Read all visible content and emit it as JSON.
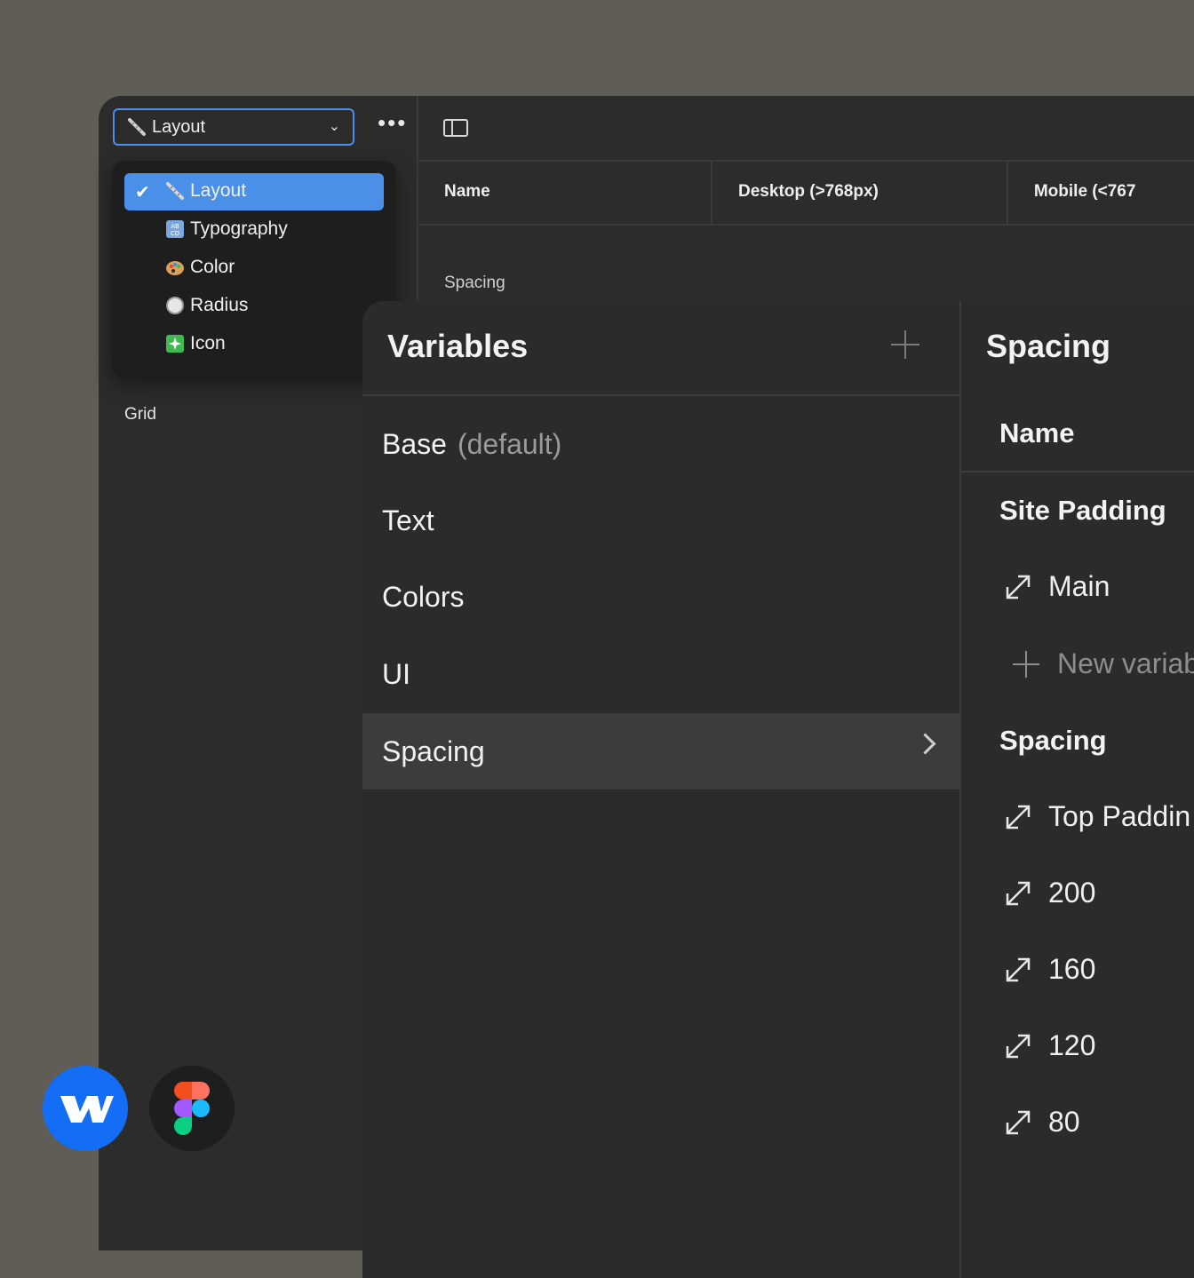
{
  "collection_select": {
    "value": "Layout"
  },
  "more_label": "•••",
  "table_headers": [
    "Name",
    "Desktop (>768px)",
    "Mobile (<767"
  ],
  "group_label": "Spacing",
  "left_group_label": "Grid",
  "dropdown": {
    "items": [
      {
        "label": "Layout",
        "icon": "ruler-icon",
        "selected": true
      },
      {
        "label": "Typography",
        "icon": "abcd-icon",
        "selected": false
      },
      {
        "label": "Color",
        "icon": "palette-icon",
        "selected": false
      },
      {
        "label": "Radius",
        "icon": "circle-icon",
        "selected": false
      },
      {
        "label": "Icon",
        "icon": "sparkle-icon",
        "selected": false
      }
    ]
  },
  "variables_panel": {
    "title": "Variables",
    "collections": [
      {
        "label": "Base",
        "suffix": "(default)"
      },
      {
        "label": "Text"
      },
      {
        "label": "Colors"
      },
      {
        "label": "UI"
      },
      {
        "label": "Spacing",
        "active": true
      }
    ]
  },
  "detail_panel": {
    "title": "Spacing",
    "name_header": "Name",
    "groups": [
      {
        "label": "Site Padding",
        "vars": [
          "Main"
        ],
        "new_label": "New variab"
      },
      {
        "label": "Spacing",
        "vars": [
          "Top Paddin",
          "200",
          "160",
          "120",
          "80"
        ]
      }
    ]
  },
  "colors": {
    "accent": "#4a90e8",
    "webflow_blue": "#146ef5"
  }
}
